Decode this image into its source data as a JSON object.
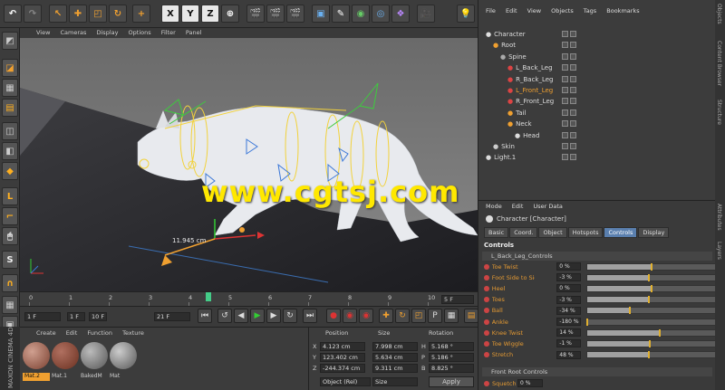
{
  "viewport": {
    "menu": [
      "View",
      "Cameras",
      "Display",
      "Options",
      "Filter",
      "Panel"
    ],
    "measure_label": "11.945 cm",
    "watermark": "www.cgtsj.com"
  },
  "toolbar": {
    "axes": [
      "X",
      "Y",
      "Z"
    ]
  },
  "left_toolbar_icons": [
    "cube-icon",
    "checker-icon",
    "polygon-icon",
    "cube-icon",
    "box-icon",
    "box-orange-icon",
    "corner-icon",
    "bracket-icon",
    "mouse-icon",
    "s-icon",
    "magnet-icon",
    "grid-icon",
    "pivot-icon"
  ],
  "object_manager": {
    "menu": [
      "File",
      "Edit",
      "View",
      "Objects",
      "Tags",
      "Bookmarks"
    ],
    "items": [
      {
        "label": "Character",
        "indent": 0
      },
      {
        "label": "Root",
        "indent": 1
      },
      {
        "label": "Spine",
        "indent": 2
      },
      {
        "label": "L_Back_Leg",
        "indent": 3
      },
      {
        "label": "R_Back_Leg",
        "indent": 3
      },
      {
        "label": "L_Front_Leg",
        "indent": 3
      },
      {
        "label": "R_Front_Leg",
        "indent": 3
      },
      {
        "label": "Tail",
        "indent": 3
      },
      {
        "label": "Neck",
        "indent": 3
      },
      {
        "label": "Head",
        "indent": 4
      },
      {
        "label": "Skin",
        "indent": 1
      },
      {
        "label": "Light.1",
        "indent": 0
      }
    ],
    "side_tabs": [
      "Objects",
      "Content Browser",
      "Structure"
    ]
  },
  "attribute_manager": {
    "menu": [
      "Mode",
      "Edit",
      "User Data"
    ],
    "title": "Character [Character]",
    "tabs": [
      "Basic",
      "Coord.",
      "Object",
      "Hotspots",
      "Controls",
      "Display"
    ],
    "active_tab": "Controls",
    "section": "Controls",
    "group1": "L_Back_Leg_Controls",
    "properties": [
      {
        "label": "Toe Twist",
        "value": "0 %",
        "fraction": 0.5
      },
      {
        "label": "Foot Side to Side",
        "value": "-3 %",
        "fraction": 0.48
      },
      {
        "label": "Heel",
        "value": "0 %",
        "fraction": 0.5
      },
      {
        "label": "Toes",
        "value": "-3 %",
        "fraction": 0.48
      },
      {
        "label": "Ball",
        "value": "-34 %",
        "fraction": 0.33
      },
      {
        "label": "Ankle",
        "value": "-180 %",
        "fraction": 0.0
      },
      {
        "label": "Knee Twist",
        "value": "14 %",
        "fraction": 0.57
      },
      {
        "label": "Toe Wiggle",
        "value": "-1 %",
        "fraction": 0.49
      },
      {
        "label": "Stretch",
        "value": "48 %",
        "fraction": 0.48
      }
    ],
    "group2": "Front Root Controls",
    "squetch": {
      "label": "Squetch",
      "value": "0 %"
    },
    "side_tabs": [
      "Attributes",
      "Layers"
    ]
  },
  "timeline": {
    "ticks": [
      "0",
      "1",
      "2",
      "3",
      "4",
      "5",
      "6",
      "7",
      "8",
      "9",
      "10"
    ],
    "current_frame": "5 F",
    "start": "1 F",
    "range": "1 F",
    "range_end": "10 F",
    "end": "21 F"
  },
  "material_manager": {
    "menu": [
      "Create",
      "Edit",
      "Function",
      "Texture"
    ],
    "materials": [
      "Mat.2",
      "Mat.1",
      "BakedM",
      "Mat"
    ]
  },
  "coordinates": {
    "headers": [
      "Position",
      "Size",
      "Rotation"
    ],
    "rows": [
      {
        "axis": "X",
        "pos": "4.123 cm",
        "size": "7.998 cm",
        "rot_axis": "H",
        "rot": "5.168 °"
      },
      {
        "axis": "Y",
        "pos": "123.402 cm",
        "size": "5.634 cm",
        "rot_axis": "P",
        "rot": "5.186 °"
      },
      {
        "axis": "Z",
        "pos": "-244.374 cm",
        "size": "9.311 cm",
        "rot_axis": "B",
        "rot": "8.825 °"
      }
    ],
    "mode": "Object (Rel)",
    "size_mode": "Size",
    "apply": "Apply"
  },
  "branding": "MAXON CINEMA 4D"
}
